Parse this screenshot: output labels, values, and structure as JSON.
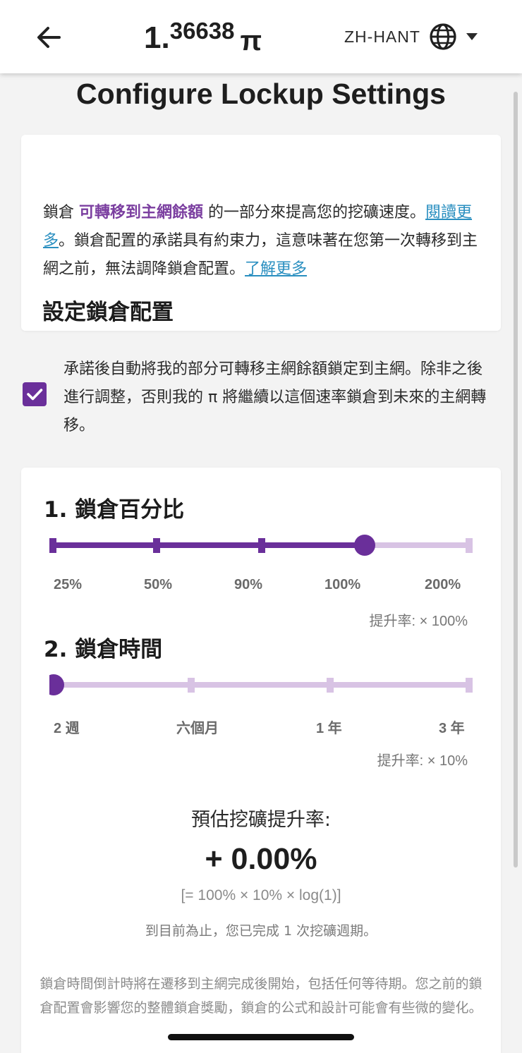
{
  "header": {
    "balance_int": "1",
    "balance_dot": ".",
    "balance_frac": "36638",
    "balance_symbol": "π",
    "language": "ZH-HANT"
  },
  "page_title": "Configure Lockup Settings",
  "info": {
    "title": "設定鎖倉配置",
    "text_1": "鎖倉 ",
    "highlight": "可轉移到主網餘額",
    "text_2": " 的一部分來提高您的挖礦速度。",
    "link_read_more": "閱讀更多",
    "text_3": "。鎖倉配置的承諾具有約束力，這意味著在您第一次轉移到主網之前，無法調降鎖倉配置。",
    "link_learn_more": "了解更多"
  },
  "commit": {
    "checked": true,
    "text": "承諾後自動將我的部分可轉移主網餘額鎖定到主網。除非之後進行調整，否則我的 π 將繼續以這個速率鎖倉到未來的主網轉移。"
  },
  "lockup_percentage": {
    "title": "1. 鎖倉百分比",
    "options": [
      "25%",
      "50%",
      "90%",
      "100%",
      "200%"
    ],
    "selected": "100%",
    "rate_text": "提升率: × 100%"
  },
  "lockup_time": {
    "title": "2. 鎖倉時間",
    "options": [
      "2 週",
      "六個月",
      "1 年",
      "3 年"
    ],
    "selected": "2 週",
    "rate_text": "提升率: × 10%"
  },
  "estimate": {
    "label": "預估挖礦提升率:",
    "value": "+ 0.00%",
    "formula": "[= 100% × 10% × log(1)]",
    "cycles": "到目前為止，您已完成 1 次挖礦週期。"
  },
  "disclaimer": "鎖倉時間倒計時將在遷移到主網完成後開始，包括任何等待期。您之前的鎖倉配置會影響您的整體鎖倉獎勵，鎖倉的公式和設計可能會有些微的變化。",
  "colors": {
    "accent": "#6a2f9a",
    "track_light": "#d8c3e4",
    "link": "#2a8fc0"
  }
}
